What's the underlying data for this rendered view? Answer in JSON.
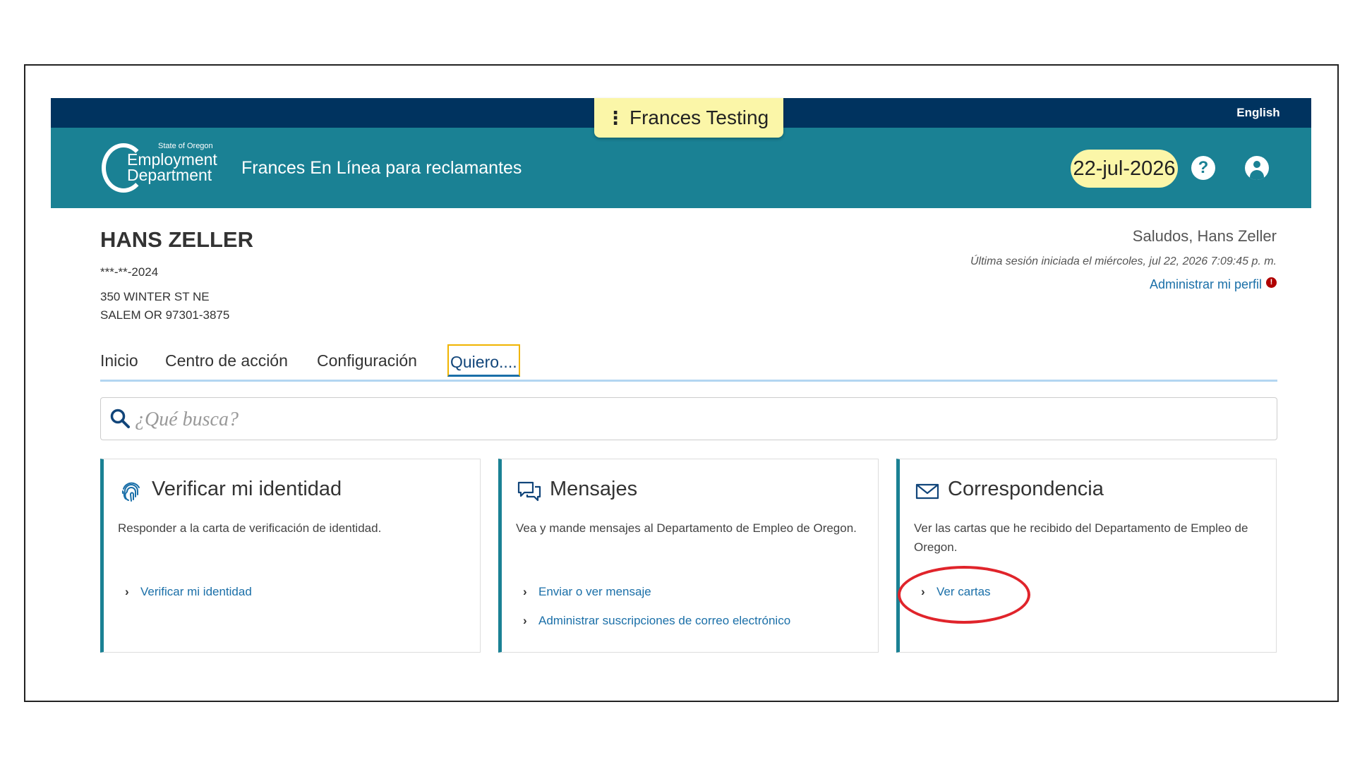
{
  "header": {
    "language_link": "English",
    "environment_label": "Frances Testing",
    "logo": {
      "small": "State of Oregon",
      "line1": "Employment",
      "line2": "Department"
    },
    "app_title": "Frances En Línea para reclamantes",
    "date": "22-jul-2026",
    "help_icon": "question-circle-icon",
    "user_icon": "user-circle-icon",
    "colors": {
      "topbar": "#00335f",
      "header": "#1a8194",
      "highlight": "#fbf6a8"
    }
  },
  "claimant": {
    "name": "HANS ZELLER",
    "ssn": "***-**-2024",
    "address1": "350 WINTER ST NE",
    "address2": "SALEM OR 97301-3875"
  },
  "session": {
    "greeting": "Saludos, Hans Zeller",
    "last_login": "Última sesión iniciada el miércoles, jul 22, 2026 7:09:45 p. m.",
    "manage_profile": "Administrar mi perfil",
    "alert_badge": "!"
  },
  "tabs": [
    {
      "label": "Inicio"
    },
    {
      "label": "Centro de acción"
    },
    {
      "label": "Configuración"
    },
    {
      "label": "Quiero...."
    }
  ],
  "search": {
    "placeholder": "¿Qué busca?"
  },
  "cards": [
    {
      "icon": "fingerprint-icon",
      "title": "Verificar mi identidad",
      "description": "Responder a la carta de verificación de identidad.",
      "links": [
        "Verificar mi identidad"
      ]
    },
    {
      "icon": "chat-bubbles-icon",
      "title": "Mensajes",
      "description": "Vea y mande mensajes al Departamento de Empleo de Oregon.",
      "links": [
        "Enviar o ver mensaje",
        "Administrar suscripciones de correo electrónico"
      ]
    },
    {
      "icon": "envelope-icon",
      "title": "Correspondencia",
      "description": "Ver las cartas que he recibido del Departamento de Empleo de Oregon.",
      "links": [
        "Ver cartas"
      ]
    }
  ],
  "annotation": {
    "color": "#e0242b"
  }
}
